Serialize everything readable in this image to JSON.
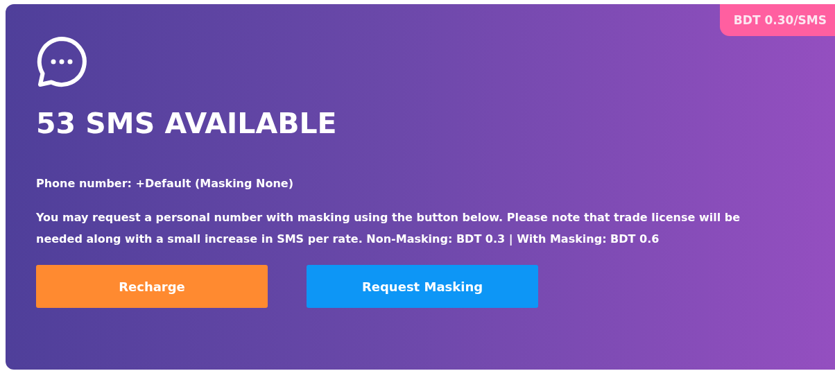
{
  "card": {
    "rate_badge": "BDT 0.30/SMS",
    "title": "53 SMS AVAILABLE",
    "phone_line": "Phone number: +Default (Masking None)",
    "description": "You may request a personal number with masking using the button below. Please note that trade license will be needed along with a small increase in SMS per rate. Non-Masking: BDT 0.3 | With Masking: BDT 0.6",
    "buttons": [
      {
        "label": "Recharge",
        "kind": "primary"
      },
      {
        "label": "Request Masking",
        "kind": "secondary"
      }
    ]
  }
}
